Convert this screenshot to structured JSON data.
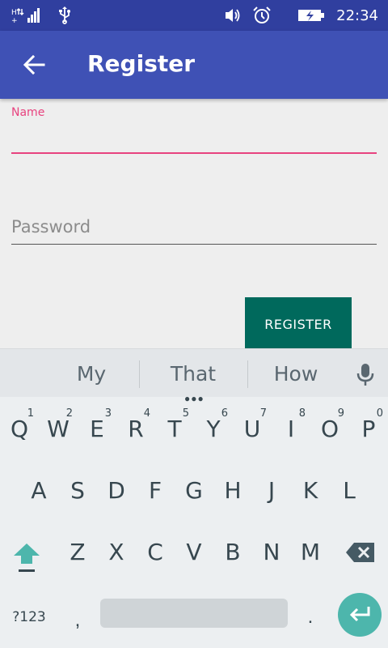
{
  "status_bar": {
    "time": "22:34"
  },
  "app_bar": {
    "title": "Register"
  },
  "form": {
    "name_label": "Name",
    "name_value": "",
    "password_placeholder": "Password",
    "password_value": "",
    "register_label": "REGISTER"
  },
  "keyboard": {
    "suggestions": [
      "My",
      "That",
      "How"
    ],
    "row1": [
      {
        "key": "Q",
        "hint": "1"
      },
      {
        "key": "W",
        "hint": "2"
      },
      {
        "key": "E",
        "hint": "3"
      },
      {
        "key": "R",
        "hint": "4"
      },
      {
        "key": "T",
        "hint": "5"
      },
      {
        "key": "Y",
        "hint": "6"
      },
      {
        "key": "U",
        "hint": "7"
      },
      {
        "key": "I",
        "hint": "8"
      },
      {
        "key": "O",
        "hint": "9"
      },
      {
        "key": "P",
        "hint": "0"
      }
    ],
    "row2": [
      "A",
      "S",
      "D",
      "F",
      "G",
      "H",
      "J",
      "K",
      "L"
    ],
    "row3": [
      "Z",
      "X",
      "C",
      "V",
      "B",
      "N",
      "M"
    ],
    "symbols_label": "?123",
    "comma": ",",
    "period": "."
  },
  "colors": {
    "status_bar": "#303f9f",
    "app_bar": "#3f51b5",
    "accent": "#e8437f",
    "button": "#00695c",
    "enter_key": "#4db6ac"
  }
}
